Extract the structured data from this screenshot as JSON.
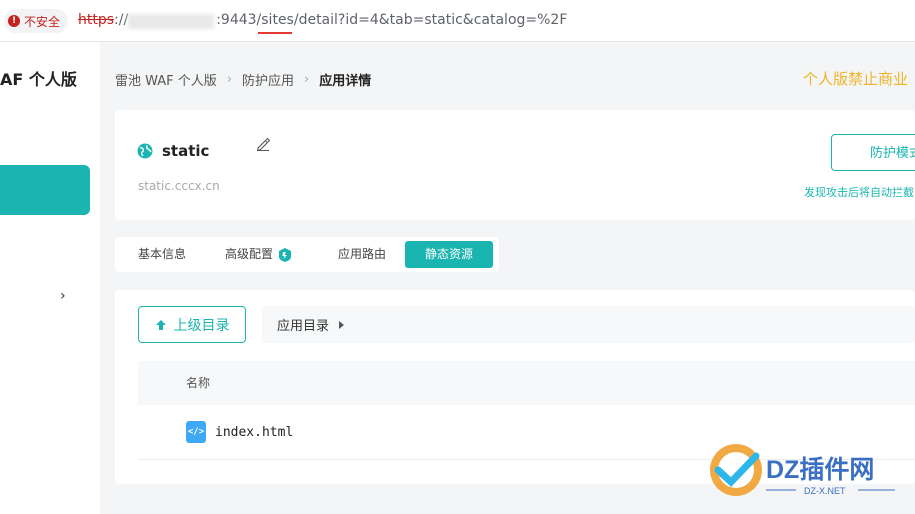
{
  "browser": {
    "security_label": "不安全",
    "url_scheme": "https",
    "url_separator": "://",
    "url_path": ":9443/sites/detail?id=4&tab=static&catalog=%2F"
  },
  "sidebar": {
    "title": "AF 个人版"
  },
  "breadcrumb": {
    "items": [
      "雷池 WAF 个人版",
      "防护应用",
      "应用详情"
    ]
  },
  "top_warning": "个人版禁止商业",
  "site": {
    "name": "static",
    "domain": "static.cccx.cn",
    "mode_button_label": "防护模式",
    "mode_hint": "发现攻击后将自动拦截"
  },
  "tabs": [
    {
      "label": "基本信息",
      "active": false
    },
    {
      "label": "高级配置",
      "active": false
    },
    {
      "label": "应用路由",
      "active": false
    },
    {
      "label": "静态资源",
      "active": true
    }
  ],
  "files": {
    "up_button_label": "上级目录",
    "current_path": "应用目录",
    "column_name": "名称",
    "rows": [
      {
        "name": "index.html",
        "icon": "code-file-icon"
      }
    ]
  },
  "watermark": {
    "brand": "DZ插件网",
    "url": "DZ-X.NET"
  },
  "colors": {
    "accent": "#1ab5b0",
    "warning": "#f0b429",
    "danger": "#c5221f"
  }
}
